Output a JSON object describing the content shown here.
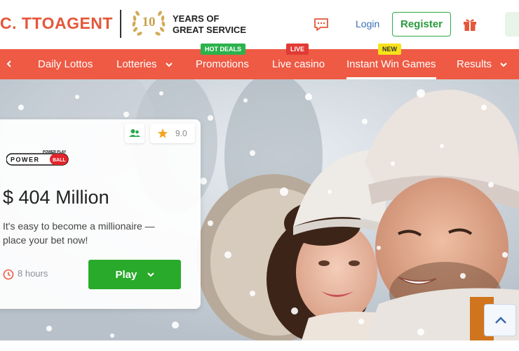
{
  "header": {
    "logo_text": "C. TTOAGENT",
    "badge_number": "10",
    "years_line1": "YEARS OF",
    "years_line2": "GREAT SERVICE",
    "login_label": "Login",
    "register_label": "Register"
  },
  "nav": {
    "items": [
      {
        "label": "Daily Lottos",
        "badge": ""
      },
      {
        "label": "Lotteries",
        "badge": ""
      },
      {
        "label": "Promotions",
        "badge": "HOT DEALS"
      },
      {
        "label": "Live casino",
        "badge": "LIVE"
      },
      {
        "label": "Instant Win Games",
        "badge": "NEW"
      },
      {
        "label": "Results",
        "badge": ""
      }
    ],
    "active_index": 4
  },
  "card": {
    "rating": "9.0",
    "logo_top": "POWER PLAY",
    "logo_left": "POWER",
    "logo_right": "BALL",
    "jackpot": "$ 404 Million",
    "description": "It's easy to become a millionaire — place your bet now!",
    "time_left": "8 hours",
    "play_label": "Play"
  },
  "colors": {
    "brand": "#ee5a44",
    "register": "#2a9a3e",
    "play": "#2aaa2a",
    "link": "#3b6fb6"
  },
  "icons": [
    "chevron-left-icon",
    "chat-icon",
    "gift-icon",
    "users-icon",
    "star-icon",
    "clock-icon",
    "chevron-down-icon",
    "chevron-up-icon"
  ]
}
